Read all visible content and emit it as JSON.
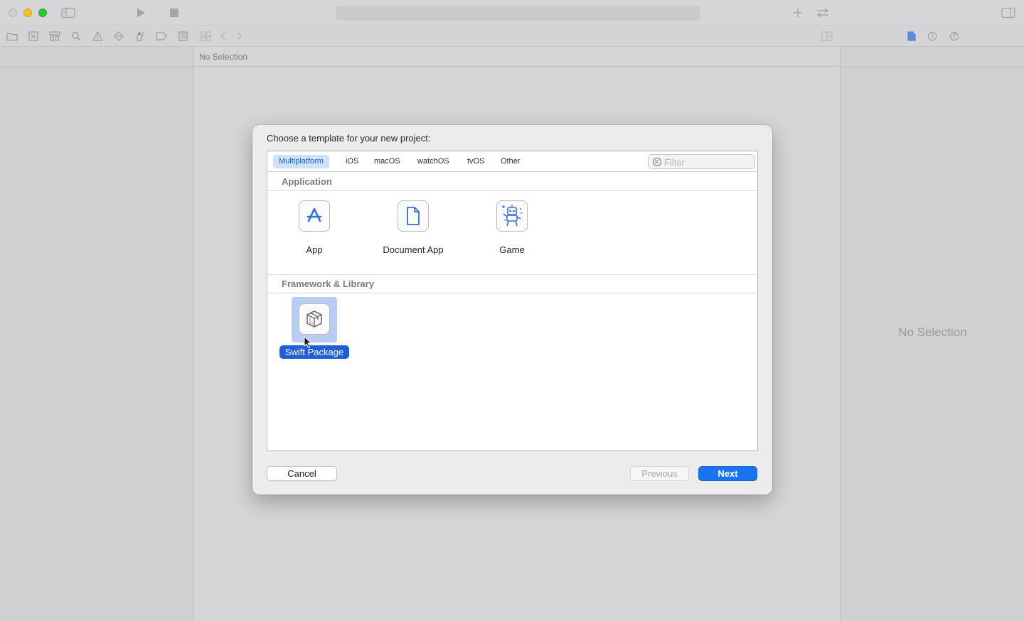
{
  "window": {
    "jumpbar_text": "No Selection",
    "inspector_text": "No Selection"
  },
  "dialog": {
    "title": "Choose a template for your new project:",
    "tabs": [
      {
        "label": "Multiplatform",
        "active": true
      },
      {
        "label": "iOS",
        "active": false
      },
      {
        "label": "macOS",
        "active": false
      },
      {
        "label": "watchOS",
        "active": false
      },
      {
        "label": "tvOS",
        "active": false
      },
      {
        "label": "Other",
        "active": false
      }
    ],
    "filter": {
      "placeholder": "Filter",
      "value": ""
    },
    "sections": [
      {
        "title": "Application",
        "templates": [
          {
            "label": "App",
            "icon": "app-store-icon"
          },
          {
            "label": "Document App",
            "icon": "document-icon"
          },
          {
            "label": "Game",
            "icon": "game-robot-icon"
          }
        ]
      },
      {
        "title": "Framework & Library",
        "templates": [
          {
            "label": "Swift Package",
            "icon": "package-icon",
            "selected": true
          }
        ]
      }
    ],
    "buttons": {
      "cancel": "Cancel",
      "previous": "Previous",
      "next": "Next"
    }
  },
  "colors": {
    "accent": "#1a73f0",
    "selection": "#1f5fd6",
    "tab_active_bg": "#cfe2fb"
  }
}
